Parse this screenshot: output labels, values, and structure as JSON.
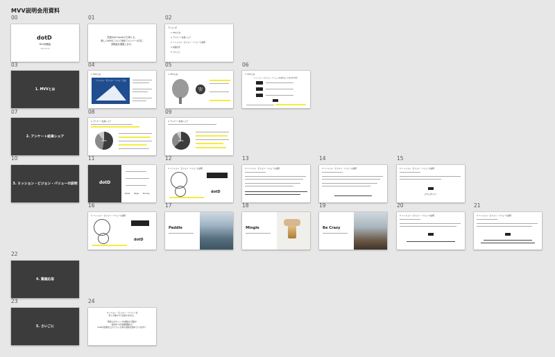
{
  "page_title": "MVV説明会用資料",
  "slides": [
    {
      "num": "00",
      "logo": "dotD",
      "line1": "MVV説明会",
      "line2": "2021.XX.XX"
    },
    {
      "num": "01",
      "text": "先週のAll handsでも申した、\n新しいMVVについて改めてメンバーの方に\n説明会を実施します。"
    },
    {
      "num": "02",
      "heading": "アジェンダ",
      "items": [
        "1. MVVとは",
        "2. アンケート結果シェア",
        "3. ミッション・ビジョン・バリューの説明",
        "4. 質疑応答",
        "5. さいごに"
      ]
    },
    {
      "num": "03",
      "section": "1. MVVとは"
    },
    {
      "num": "04",
      "heading": "1. MVVとは",
      "banner": "ミッション・ビジョン・バリューとは"
    },
    {
      "num": "05",
      "heading": "1. MVVとは",
      "badge": "企業の\n目的"
    },
    {
      "num": "06",
      "heading": "1. MVVとは",
      "text": "ミッション・ビジョン・バリューを決めることはなぜ大切？"
    },
    {
      "num": "07",
      "section": "2. アンケート結果シェア"
    },
    {
      "num": "08",
      "heading": "2. アンケート結果シェア",
      "pie_label": "53%"
    },
    {
      "num": "09",
      "heading": "2. アンケート結果シェア",
      "pie_label": "62%"
    },
    {
      "num": "10",
      "section": "3. ミッション・ビジョン・バリューの説明"
    },
    {
      "num": "11",
      "logo": "dotD",
      "labels": [
        "Paddle",
        "Mingle",
        "Be Crazy"
      ]
    },
    {
      "num": "12",
      "heading": "3. ミッション・ビジョン・バリューの説明",
      "logo": "dotD"
    },
    {
      "num": "13",
      "heading": "3. ミッション・ビジョン・バリューの説明"
    },
    {
      "num": "14",
      "heading": "3. ミッション・ビジョン・バリューの説明"
    },
    {
      "num": "15",
      "heading": "3. ミッション・ビジョン・バリューの説明",
      "text": "どちらがいい？"
    },
    {
      "num": "16",
      "heading": "3. ミッション・ビジョン・バリューの説明",
      "logo": "dotD"
    },
    {
      "num": "17",
      "word": "Paddle"
    },
    {
      "num": "18",
      "word": "Mingle"
    },
    {
      "num": "19",
      "word": "Be Crazy"
    },
    {
      "num": "20",
      "heading": "3. ミッション・ビジョン・バリューの説明"
    },
    {
      "num": "21",
      "heading": "3. ミッション・ビジョン・バリューの説明"
    },
    {
      "num": "22",
      "section": "4. 質疑応答"
    },
    {
      "num": "23",
      "section": "5. さいごに"
    },
    {
      "num": "24",
      "text": "ミッション・ビジョン・バリューは\n作って終わりではありません。\n\n現状とのギャップを埋める活動や\n社内外への浸透施策など\ndotDの目標を上げていくための活動を進めていきます！"
    }
  ],
  "colors": {
    "canvas": "#e7e7e7",
    "section_bg": "#3c3c3c",
    "highlight": "#f5ec3d"
  }
}
